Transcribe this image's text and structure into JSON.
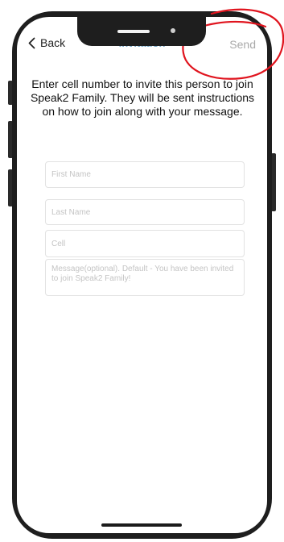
{
  "nav": {
    "back_label": "Back",
    "title": "Invitation",
    "send_label": "Send"
  },
  "instructions": "Enter cell number to invite this person to join Speak2 Family. They will be sent instructions on how to join along with your message.",
  "form": {
    "first_name_placeholder": "First Name",
    "last_name_placeholder": "Last Name",
    "cell_placeholder": "Cell",
    "message_placeholder": "Message(optional). Default - You have been invited to join Speak2 Family!"
  },
  "colors": {
    "title": "#6aa3c9",
    "send_disabled": "#a9a9a9",
    "annotation": "#e0141e",
    "phone_frame": "#1e1e1e"
  },
  "icons": {
    "back": "chevron-left-icon"
  }
}
